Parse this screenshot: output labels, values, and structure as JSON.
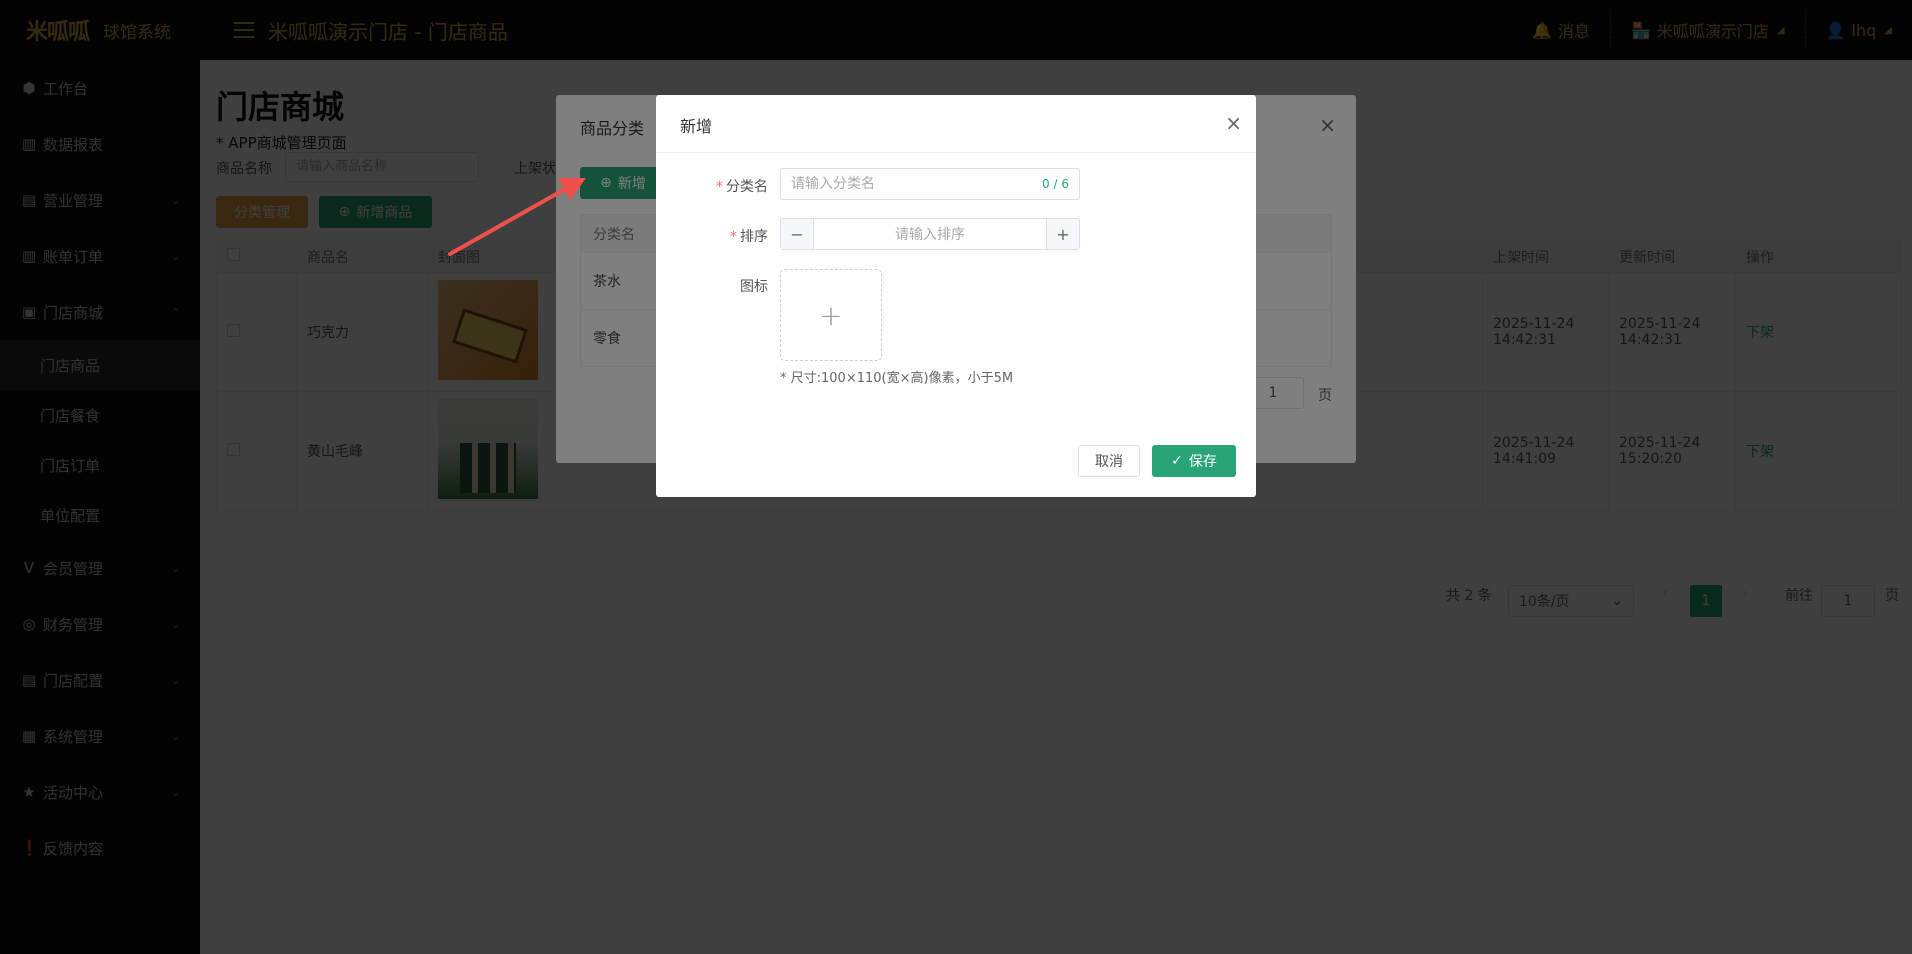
{
  "app": {
    "logo": "米呱呱",
    "name": "球馆系统",
    "page_title": "米呱呱演示门店 - 门店商品"
  },
  "topbar": {
    "messages_label": "消息",
    "store_label": "米呱呱演示门店",
    "user_label": "lhq"
  },
  "sidebar": {
    "items": [
      {
        "label": "工作台",
        "icon": "cube-icon"
      },
      {
        "label": "数据报表",
        "icon": "bar-chart-icon"
      },
      {
        "label": "营业管理",
        "icon": "shop-icon"
      },
      {
        "label": "账单订单",
        "icon": "bar-chart-icon"
      },
      {
        "label": "门店商城",
        "icon": "bag-icon"
      },
      {
        "label": "会员管理",
        "icon": "v-icon"
      },
      {
        "label": "财务管理",
        "icon": "coins-icon"
      },
      {
        "label": "门店配置",
        "icon": "store-icon"
      },
      {
        "label": "系统管理",
        "icon": "grid-icon"
      },
      {
        "label": "活动中心",
        "icon": "star-icon"
      },
      {
        "label": "反馈内容",
        "icon": "feedback-icon"
      }
    ],
    "subitems": [
      "门店商品",
      "门店餐食",
      "门店订单",
      "单位配置"
    ]
  },
  "main": {
    "title": "门店商城",
    "subtitle": "* APP商城管理页面",
    "filter_label": "商品名称",
    "filter_placeholder": "请输入商品名称",
    "filter_label2": "上架状",
    "category_button": "分类管理",
    "add_product_button": "新增商品",
    "columns": [
      "商品名",
      "封面图",
      "上架时间",
      "更新时间",
      "操作"
    ],
    "rows": [
      {
        "name": "巧克力",
        "on_time": "2025-11-24 14:42:31",
        "update_time": "2025-11-24 14:42:31",
        "action": "下架"
      },
      {
        "name": "黄山毛峰",
        "on_time": "2025-11-24 14:41:09",
        "update_time": "2025-11-24 15:20:20",
        "action": "下架"
      }
    ],
    "pager": {
      "total": "共 2 条",
      "page_size": "10条/页",
      "current": "1",
      "goto_label": "前往",
      "goto_value": "1",
      "unit": "页"
    }
  },
  "category_dialog": {
    "title": "商品分类",
    "add_button": "新增",
    "column": "分类名",
    "rows": [
      "茶水",
      "零食"
    ],
    "page_value": "1",
    "page_unit": "页"
  },
  "add_dialog": {
    "title": "新增",
    "name_label": "分类名",
    "name_placeholder": "请输入分类名",
    "name_count": "0 / 6",
    "order_label": "排序",
    "order_placeholder": "请输入排序",
    "icon_label": "图标",
    "hint": "* 尺寸:100×110(宽×高)像素，小于5M",
    "cancel_label": "取消",
    "save_label": "保存"
  },
  "colors": {
    "brand": "#d9a54a",
    "primary": "#28a477",
    "warning": "#e6a23c",
    "arrow": "#f0504a"
  }
}
